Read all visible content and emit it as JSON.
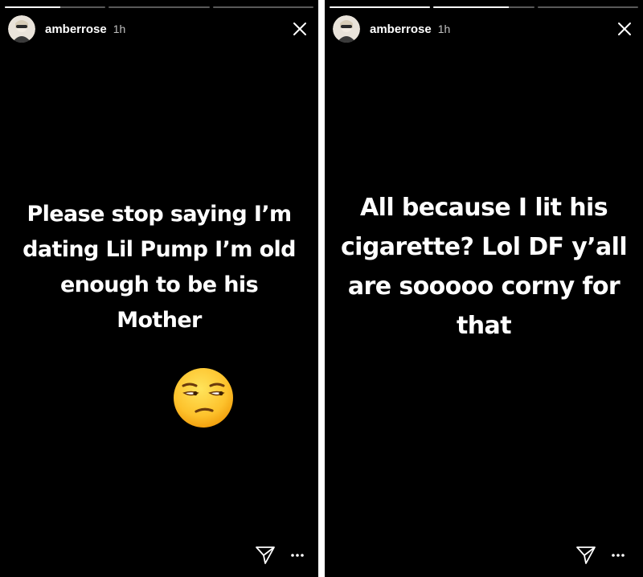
{
  "stories": [
    {
      "progress": [
        0.55,
        0,
        0
      ],
      "header": {
        "username": "amberrose",
        "time": "1h",
        "avatar": "user-avatar",
        "close_icon": "close-icon"
      },
      "caption_lines": [
        "Please stop saying I’m",
        "dating Lil Pump I’m old",
        "enough to be his",
        "Mother"
      ],
      "emoji": "unamused-face-emoji",
      "footer": {
        "send_icon": "send-icon",
        "more_icon": "more-icon"
      }
    },
    {
      "progress": [
        1,
        0.75,
        0
      ],
      "header": {
        "username": "amberrose",
        "time": "1h",
        "avatar": "user-avatar",
        "close_icon": "close-icon"
      },
      "caption_lines": [
        "All because I lit his",
        "cigarette?  Lol  DF y’all",
        "are sooooo corny for",
        "that"
      ],
      "footer": {
        "send_icon": "send-icon",
        "more_icon": "more-icon"
      }
    }
  ],
  "colors": {
    "background": "#000000",
    "text": "#ffffff",
    "progress_track": "rgba(255,255,255,0.35)",
    "progress_fill": "#ffffff"
  }
}
